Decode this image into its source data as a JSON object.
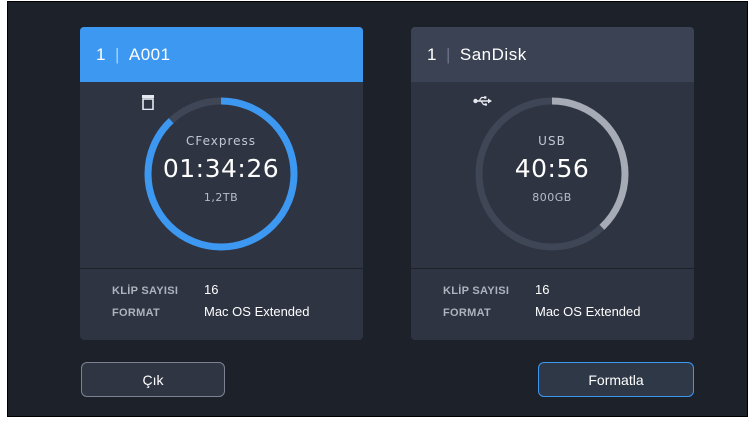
{
  "slots": [
    {
      "slot_number": "1",
      "separator": "|",
      "name": "A001",
      "media_icon": "cfexpress-card-icon",
      "media_type": "CFexpress",
      "time_remaining": "01:34:26",
      "capacity": "1,2TB",
      "remaining_fraction": 0.88,
      "arc_color": "#3d98f2",
      "clip_count_label": "KLİP SAYISI",
      "clip_count": "16",
      "format_label": "FORMAT",
      "format_value": "Mac OS Extended"
    },
    {
      "slot_number": "1",
      "separator": "|",
      "name": "SanDisk",
      "media_icon": "usb-icon",
      "media_type": "USB",
      "time_remaining": "40:56",
      "capacity": "800GB",
      "remaining_fraction": 0.38,
      "arc_color": "#a6abb6",
      "clip_count_label": "KLİP SAYISI",
      "clip_count": "16",
      "format_label": "FORMAT",
      "format_value": "Mac OS Extended"
    }
  ],
  "buttons": {
    "exit_label": "Çık",
    "format_label": "Formatla"
  },
  "colors": {
    "accent": "#3d98f2",
    "background": "#1d212a",
    "card": "#2e3441"
  }
}
